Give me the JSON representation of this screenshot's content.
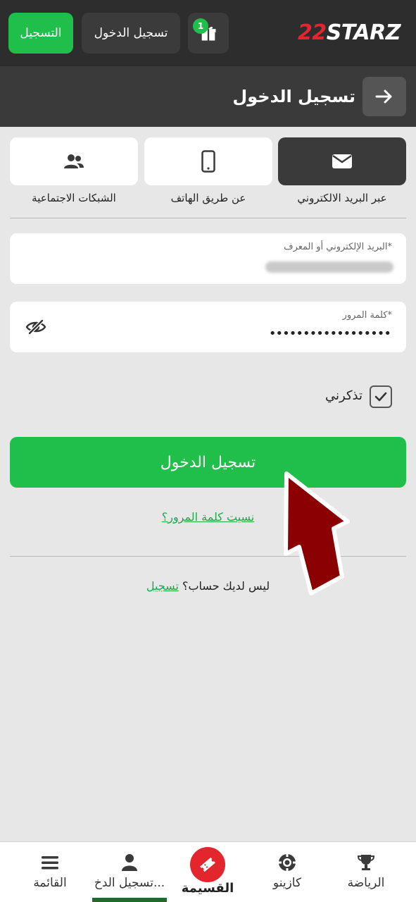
{
  "header": {
    "register_label": "التسجيل",
    "login_label": "تسجيل الدخول",
    "gift_badge": "1",
    "logo_prefix": "22",
    "logo_text": "STARZ"
  },
  "page": {
    "title": "تسجيل الدخول"
  },
  "tabs": [
    {
      "label": "عبر البريد الالكتروني",
      "icon": "envelope-icon",
      "active": true
    },
    {
      "label": "عن طريق الهاتف",
      "icon": "phone-icon",
      "active": false
    },
    {
      "label": "الشبكات الاجتماعية",
      "icon": "users-icon",
      "active": false
    }
  ],
  "form": {
    "email_label": "البريد الإلكتروني أو المعرف*",
    "password_label": "كلمة المرور*",
    "password_value": "••••••••••••••••••",
    "remember_label": "تذكرني",
    "remember_checked": true,
    "submit_label": "تسجيل الدخول",
    "forgot_label": "نسيت كلمة المرور؟",
    "no_account_text": "ليس لديك حساب؟",
    "signup_link": "تسجيل"
  },
  "bottom_nav": [
    {
      "label": "الرياضة",
      "icon": "trophy-icon"
    },
    {
      "label": "كازينو",
      "icon": "chip-icon"
    },
    {
      "label": "القسيمة",
      "icon": "ticket-icon"
    },
    {
      "label": "تسجيل الدخ...",
      "icon": "user-icon",
      "active": true
    },
    {
      "label": "القائمة",
      "icon": "menu-icon"
    }
  ],
  "colors": {
    "accent_green": "#1fbf4a",
    "brand_red": "#e3262e",
    "annotation_arrow": "#8b0000"
  }
}
